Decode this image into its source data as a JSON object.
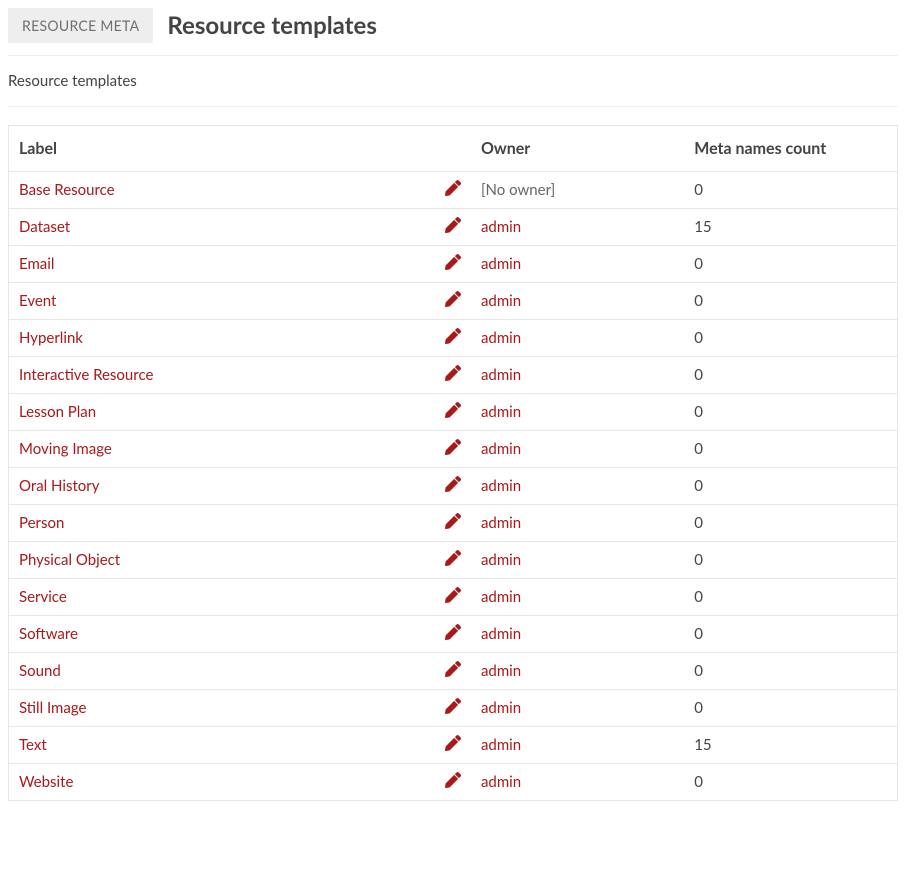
{
  "header": {
    "badge": "RESOURCE META",
    "title": "Resource templates"
  },
  "subtitle": "Resource templates",
  "columns": {
    "label": "Label",
    "owner": "Owner",
    "count": "Meta names count"
  },
  "no_owner_text": "[No owner]",
  "rows": [
    {
      "label": "Base Resource",
      "owner": null,
      "count": 0
    },
    {
      "label": "Dataset",
      "owner": "admin",
      "count": 15
    },
    {
      "label": "Email",
      "owner": "admin",
      "count": 0
    },
    {
      "label": "Event",
      "owner": "admin",
      "count": 0
    },
    {
      "label": "Hyperlink",
      "owner": "admin",
      "count": 0
    },
    {
      "label": "Interactive Resource",
      "owner": "admin",
      "count": 0
    },
    {
      "label": "Lesson Plan",
      "owner": "admin",
      "count": 0
    },
    {
      "label": "Moving Image",
      "owner": "admin",
      "count": 0
    },
    {
      "label": "Oral History",
      "owner": "admin",
      "count": 0
    },
    {
      "label": "Person",
      "owner": "admin",
      "count": 0
    },
    {
      "label": "Physical Object",
      "owner": "admin",
      "count": 0
    },
    {
      "label": "Service",
      "owner": "admin",
      "count": 0
    },
    {
      "label": "Software",
      "owner": "admin",
      "count": 0
    },
    {
      "label": "Sound",
      "owner": "admin",
      "count": 0
    },
    {
      "label": "Still Image",
      "owner": "admin",
      "count": 0
    },
    {
      "label": "Text",
      "owner": "admin",
      "count": 15
    },
    {
      "label": "Website",
      "owner": "admin",
      "count": 0
    }
  ]
}
